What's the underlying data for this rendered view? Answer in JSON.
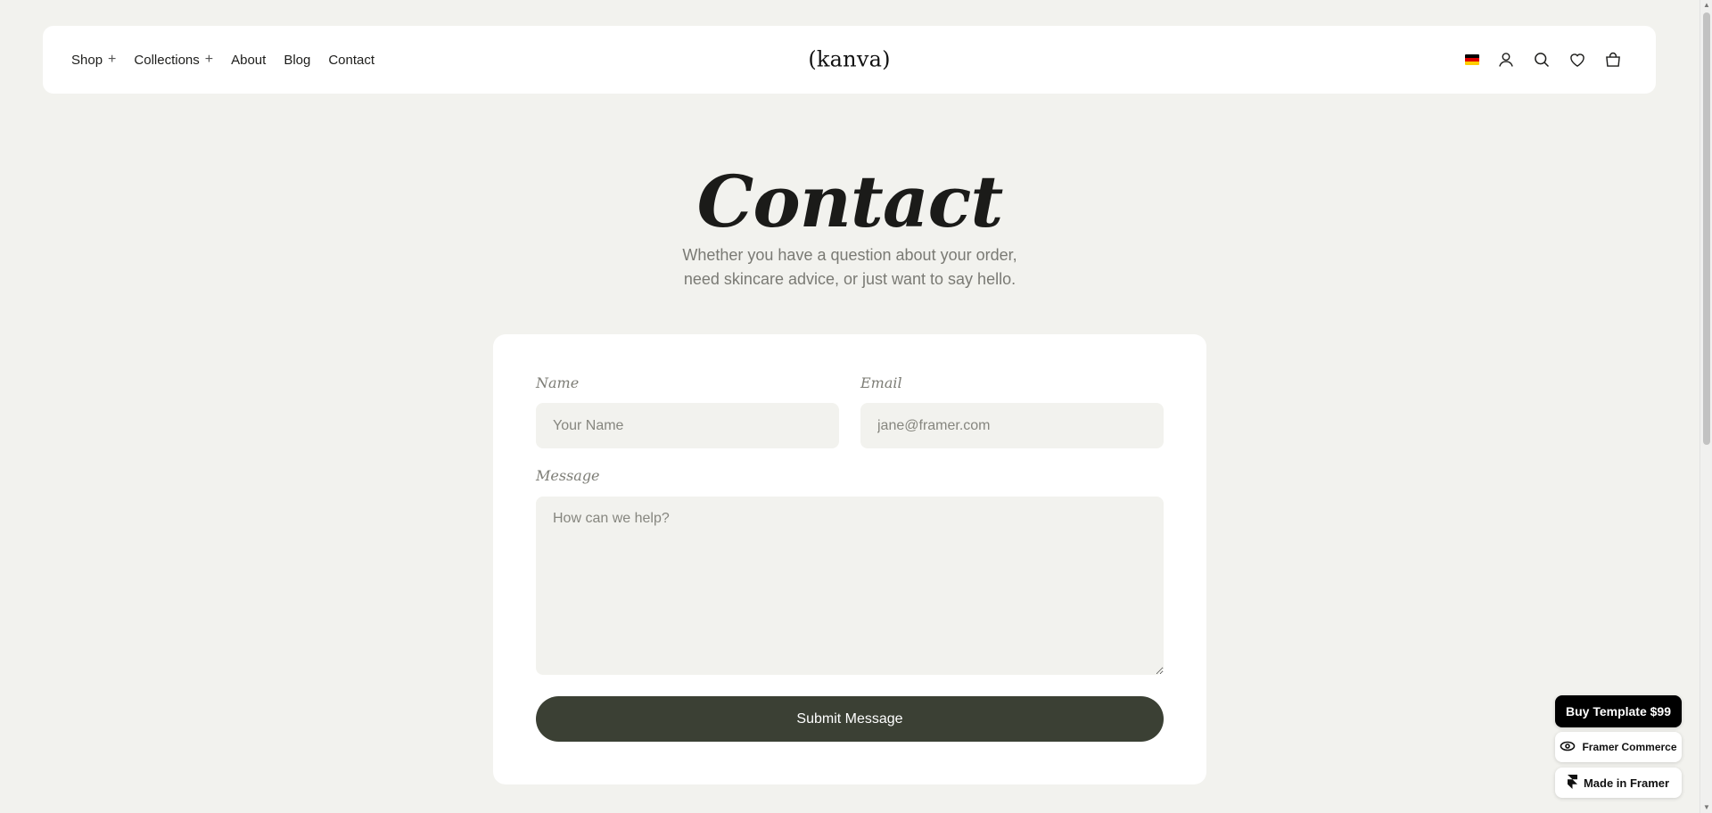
{
  "nav": {
    "items": [
      {
        "label": "Shop",
        "expandable": true
      },
      {
        "label": "Collections",
        "expandable": true
      },
      {
        "label": "About",
        "expandable": false
      },
      {
        "label": "Blog",
        "expandable": false
      },
      {
        "label": "Contact",
        "expandable": false
      }
    ],
    "expand_glyph": "+"
  },
  "brand": {
    "logo": "(kanva)"
  },
  "header_icons": [
    "german-flag-icon",
    "user-icon",
    "search-icon",
    "heart-icon",
    "bag-icon"
  ],
  "hero": {
    "title": "Contact",
    "subtitle_line1": "Whether you have a question about your order,",
    "subtitle_line2": "need skincare advice, or just want to say hello."
  },
  "form": {
    "name_label": "Name",
    "name_placeholder": "Your Name",
    "email_label": "Email",
    "email_placeholder": "jane@framer.com",
    "message_label": "Message",
    "message_placeholder": "How can we help?",
    "submit_label": "Submit Message"
  },
  "badges": {
    "buy": "Buy Template $99",
    "framer_commerce": "Framer Commerce",
    "made_in_framer": "Made in Framer"
  },
  "colors": {
    "page_bg": "#f2f2ee",
    "card_bg": "#ffffff",
    "button_bg": "#3b4034",
    "muted_text": "#7a7a74"
  }
}
